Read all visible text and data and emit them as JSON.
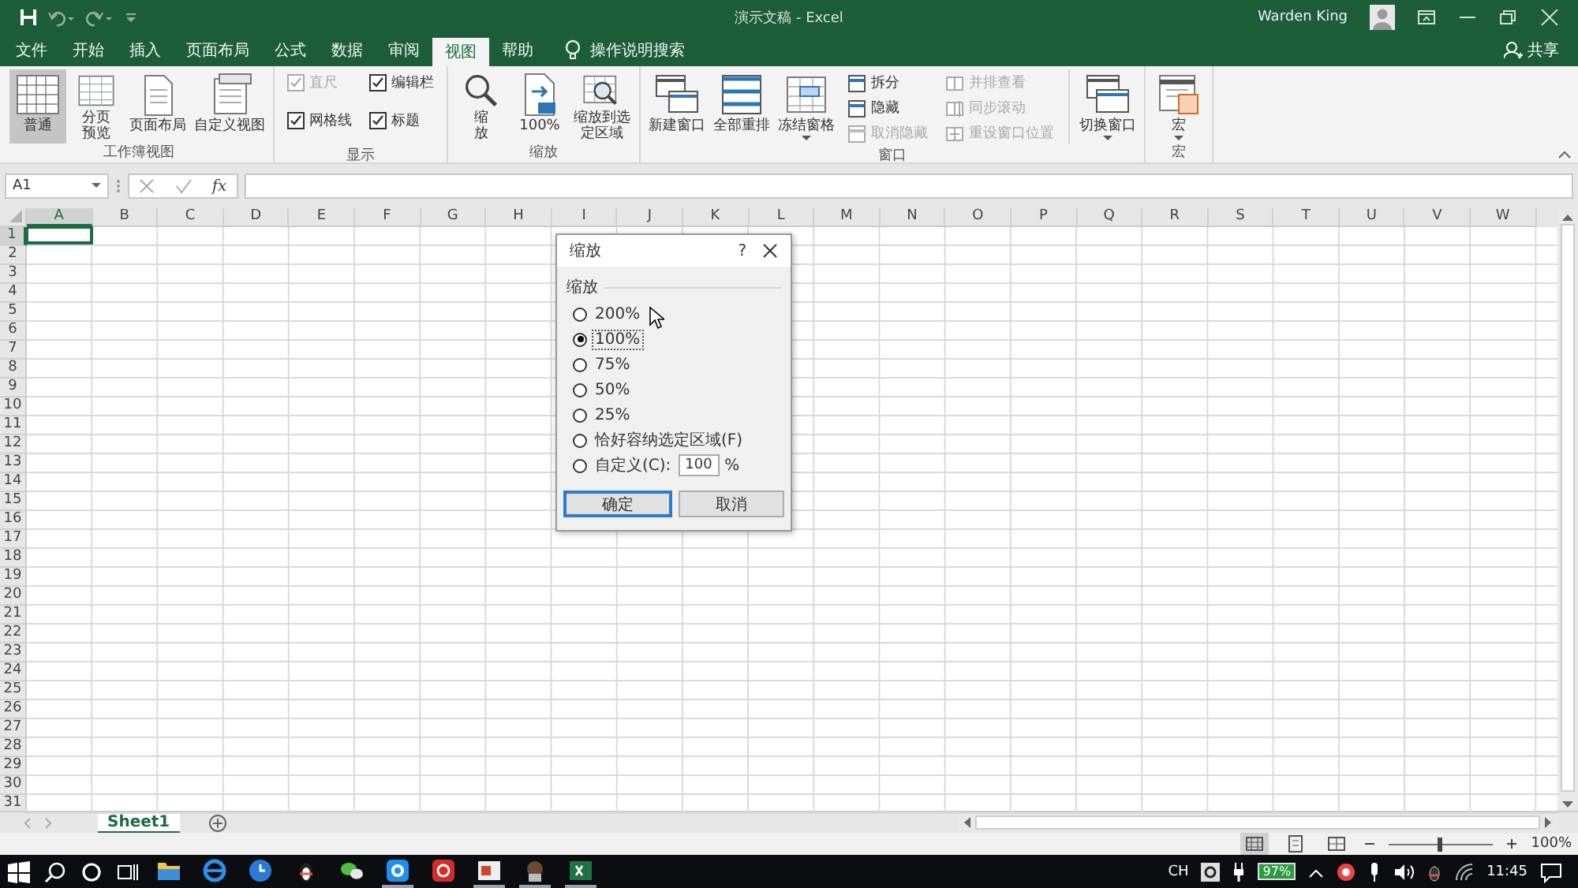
{
  "window": {
    "title": "演示文稿 - Excel",
    "user": "Warden King"
  },
  "tabs": [
    {
      "label": "文件",
      "selected": false
    },
    {
      "label": "开始",
      "selected": false
    },
    {
      "label": "插入",
      "selected": false
    },
    {
      "label": "页面布局",
      "selected": false
    },
    {
      "label": "公式",
      "selected": false
    },
    {
      "label": "数据",
      "selected": false
    },
    {
      "label": "审阅",
      "selected": false
    },
    {
      "label": "视图",
      "selected": true
    },
    {
      "label": "帮助",
      "selected": false
    }
  ],
  "tell_me": {
    "label": "操作说明搜索"
  },
  "share": {
    "label": "共享"
  },
  "ribbon": {
    "groups": [
      {
        "name": "工作簿视图",
        "items": [
          {
            "kind": "large",
            "label": "普通",
            "selected": true
          },
          {
            "kind": "large",
            "label": "分页预览",
            "selected": false
          },
          {
            "kind": "large",
            "label": "页面布局",
            "selected": false
          },
          {
            "kind": "large",
            "label": "自定义视图",
            "selected": false
          }
        ]
      },
      {
        "name": "显示",
        "items": [
          {
            "kind": "stack",
            "items": [
              {
                "kind": "check",
                "label": "直尺",
                "checked": true,
                "disabled": true
              },
              {
                "kind": "check",
                "label": "网格线",
                "checked": true,
                "disabled": false
              }
            ]
          },
          {
            "kind": "stack",
            "items": [
              {
                "kind": "check",
                "label": "编辑栏",
                "checked": true,
                "disabled": false
              },
              {
                "kind": "check",
                "label": "标题",
                "checked": true,
                "disabled": false
              }
            ]
          }
        ]
      },
      {
        "name": "缩放",
        "items": [
          {
            "kind": "large",
            "label": "缩放",
            "selected": false
          },
          {
            "kind": "large",
            "label": "100%",
            "selected": false
          },
          {
            "kind": "large",
            "label": "缩放到选定区域",
            "selected": false
          }
        ]
      },
      {
        "name": "窗口",
        "items": [
          {
            "kind": "large",
            "label": "新建窗口",
            "selected": false
          },
          {
            "kind": "large",
            "label": "全部重排",
            "selected": false
          },
          {
            "kind": "large",
            "label": "冻结窗格",
            "selected": false,
            "dropdown": true
          },
          {
            "kind": "stack",
            "items": [
              {
                "kind": "button",
                "label": "拆分",
                "disabled": false
              },
              {
                "kind": "button",
                "label": "隐藏",
                "disabled": false
              },
              {
                "kind": "button",
                "label": "取消隐藏",
                "disabled": true
              }
            ]
          },
          {
            "kind": "stack",
            "items": [
              {
                "kind": "button",
                "label": "并排查看",
                "disabled": true
              },
              {
                "kind": "button",
                "label": "同步滚动",
                "disabled": true
              },
              {
                "kind": "button",
                "label": "重设窗口位置",
                "disabled": true
              }
            ]
          },
          {
            "kind": "divider"
          },
          {
            "kind": "large",
            "label": "切换窗口",
            "selected": false,
            "dropdown": true
          }
        ]
      },
      {
        "name": "宏",
        "items": [
          {
            "kind": "large",
            "label": "宏",
            "selected": false,
            "dropdown": true
          }
        ]
      }
    ]
  },
  "formula_bar": {
    "name_box": "A1",
    "function_label": "fx"
  },
  "columns": [
    {
      "label": "A",
      "selected": true
    },
    {
      "label": "B",
      "selected": false
    },
    {
      "label": "C",
      "selected": false
    },
    {
      "label": "D",
      "selected": false
    },
    {
      "label": "E",
      "selected": false
    },
    {
      "label": "F",
      "selected": false
    },
    {
      "label": "G",
      "selected": false
    },
    {
      "label": "H",
      "selected": false
    },
    {
      "label": "I",
      "selected": false
    },
    {
      "label": "J",
      "selected": false
    },
    {
      "label": "K",
      "selected": false
    },
    {
      "label": "L",
      "selected": false
    },
    {
      "label": "M",
      "selected": false
    },
    {
      "label": "N",
      "selected": false
    },
    {
      "label": "O",
      "selected": false
    },
    {
      "label": "P",
      "selected": false
    },
    {
      "label": "Q",
      "selected": false
    },
    {
      "label": "R",
      "selected": false
    },
    {
      "label": "S",
      "selected": false
    },
    {
      "label": "T",
      "selected": false
    },
    {
      "label": "U",
      "selected": false
    },
    {
      "label": "V",
      "selected": false
    },
    {
      "label": "W",
      "selected": false
    }
  ],
  "rows": [
    {
      "label": "1",
      "selected": true
    },
    {
      "label": "2",
      "selected": false
    },
    {
      "label": "3",
      "selected": false
    },
    {
      "label": "4",
      "selected": false
    },
    {
      "label": "5",
      "selected": false
    },
    {
      "label": "6",
      "selected": false
    },
    {
      "label": "7",
      "selected": false
    },
    {
      "label": "8",
      "selected": false
    },
    {
      "label": "9",
      "selected": false
    },
    {
      "label": "10",
      "selected": false
    },
    {
      "label": "11",
      "selected": false
    },
    {
      "label": "12",
      "selected": false
    },
    {
      "label": "13",
      "selected": false
    },
    {
      "label": "14",
      "selected": false
    },
    {
      "label": "15",
      "selected": false
    },
    {
      "label": "16",
      "selected": false
    },
    {
      "label": "17",
      "selected": false
    },
    {
      "label": "18",
      "selected": false
    },
    {
      "label": "19",
      "selected": false
    },
    {
      "label": "20",
      "selected": false
    },
    {
      "label": "21",
      "selected": false
    },
    {
      "label": "22",
      "selected": false
    },
    {
      "label": "23",
      "selected": false
    },
    {
      "label": "24",
      "selected": false
    },
    {
      "label": "25",
      "selected": false
    },
    {
      "label": "26",
      "selected": false
    },
    {
      "label": "27",
      "selected": false
    },
    {
      "label": "28",
      "selected": false
    },
    {
      "label": "29",
      "selected": false
    },
    {
      "label": "30",
      "selected": false
    },
    {
      "label": "31",
      "selected": false
    }
  ],
  "dialog": {
    "title": "缩放",
    "help": "?",
    "group_label": "缩放",
    "options": [
      {
        "kind": "preset",
        "label": "200%",
        "selected": false
      },
      {
        "kind": "preset",
        "label": "100%",
        "selected": true
      },
      {
        "kind": "preset",
        "label": "75%",
        "selected": false
      },
      {
        "kind": "preset",
        "label": "50%",
        "selected": false
      },
      {
        "kind": "preset",
        "label": "25%",
        "selected": false
      },
      {
        "kind": "preset",
        "label": "恰好容纳选定区域(F)",
        "selected": false
      },
      {
        "kind": "custom",
        "label": "自定义(C):",
        "selected": false
      }
    ],
    "custom_value": "100",
    "unit": "%",
    "buttons": [
      {
        "label": "确定",
        "default": true
      },
      {
        "label": "取消",
        "default": false
      }
    ]
  },
  "sheet_tabs": [
    {
      "label": "Sheet1",
      "selected": true
    }
  ],
  "status_bar": {
    "views": [
      {
        "selected": true
      },
      {
        "selected": false
      },
      {
        "selected": false
      }
    ],
    "zoom": {
      "level": 0.5,
      "label": "100%"
    }
  },
  "taskbar": {
    "apps": [
      {
        "running": false
      },
      {
        "running": false
      },
      {
        "running": false
      },
      {
        "running": false
      },
      {
        "running": false
      },
      {
        "running": true
      },
      {
        "running": false
      },
      {
        "running": true
      },
      {
        "running": true
      },
      {
        "running": true
      }
    ],
    "input_language": "CH",
    "battery": "97%",
    "time": "11:45"
  }
}
